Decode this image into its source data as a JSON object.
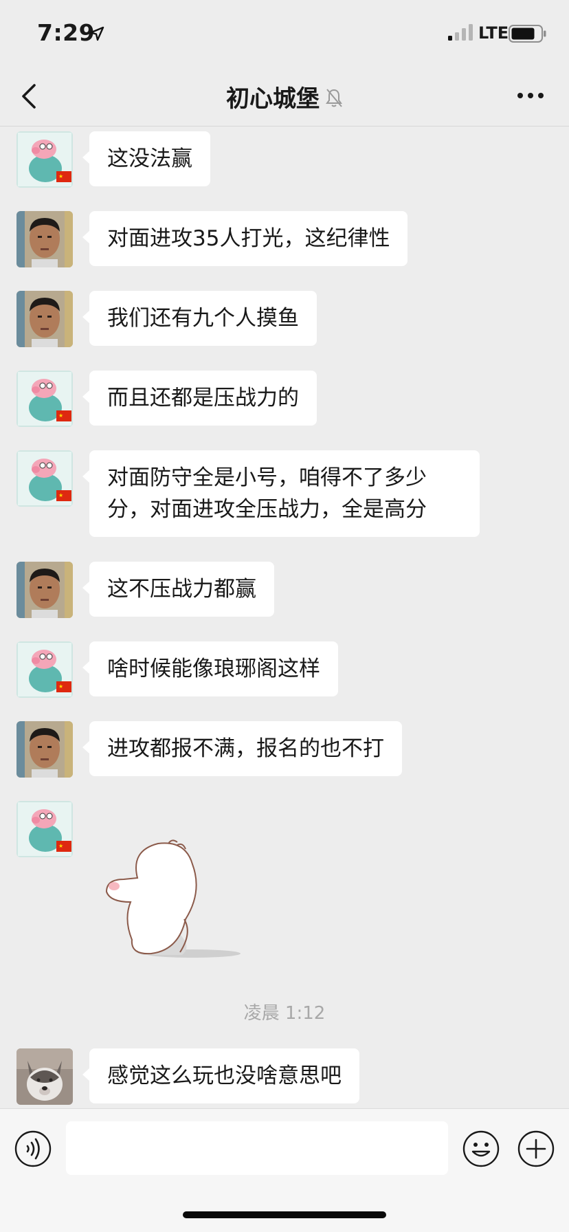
{
  "status_bar": {
    "time": "7:29",
    "network": "LTE",
    "icons": [
      "location-arrow-icon",
      "signal-icon",
      "battery-icon"
    ]
  },
  "nav": {
    "title": "初心城堡",
    "icons": [
      "back-icon",
      "mute-bell-icon",
      "more-icon"
    ]
  },
  "messages": [
    {
      "avatar": "peppa-avatar",
      "text": "这没法赢"
    },
    {
      "avatar": "man-avatar",
      "text": "对面进攻35人打光，这纪律性"
    },
    {
      "avatar": "man-avatar",
      "text": "我们还有九个人摸鱼"
    },
    {
      "avatar": "peppa-avatar",
      "text": "而且还都是压战力的"
    },
    {
      "avatar": "peppa-avatar",
      "text": "对面防守全是小号，咱得不了多少分，对面进攻全压战力，全是高分"
    },
    {
      "avatar": "man-avatar",
      "text": "这不压战力都赢"
    },
    {
      "avatar": "peppa-avatar",
      "text": "啥时候能像琅琊阁这样"
    },
    {
      "avatar": "man-avatar",
      "text": "进攻都报不满，报名的也不打"
    },
    {
      "avatar": "peppa-avatar",
      "sticker": "cute-bun-sticker"
    },
    {
      "avatar": "husky-avatar",
      "text": "感觉这么玩也没啥意思吧"
    }
  ],
  "timestamp": "凌晨 1:12",
  "input_bar": {
    "value": "",
    "icons": [
      "voice-icon",
      "emoji-icon",
      "plus-icon"
    ]
  },
  "colors": {
    "background": "#ededed",
    "bubble": "#ffffff",
    "text": "#191919",
    "timestamp": "#a8a8a8"
  }
}
